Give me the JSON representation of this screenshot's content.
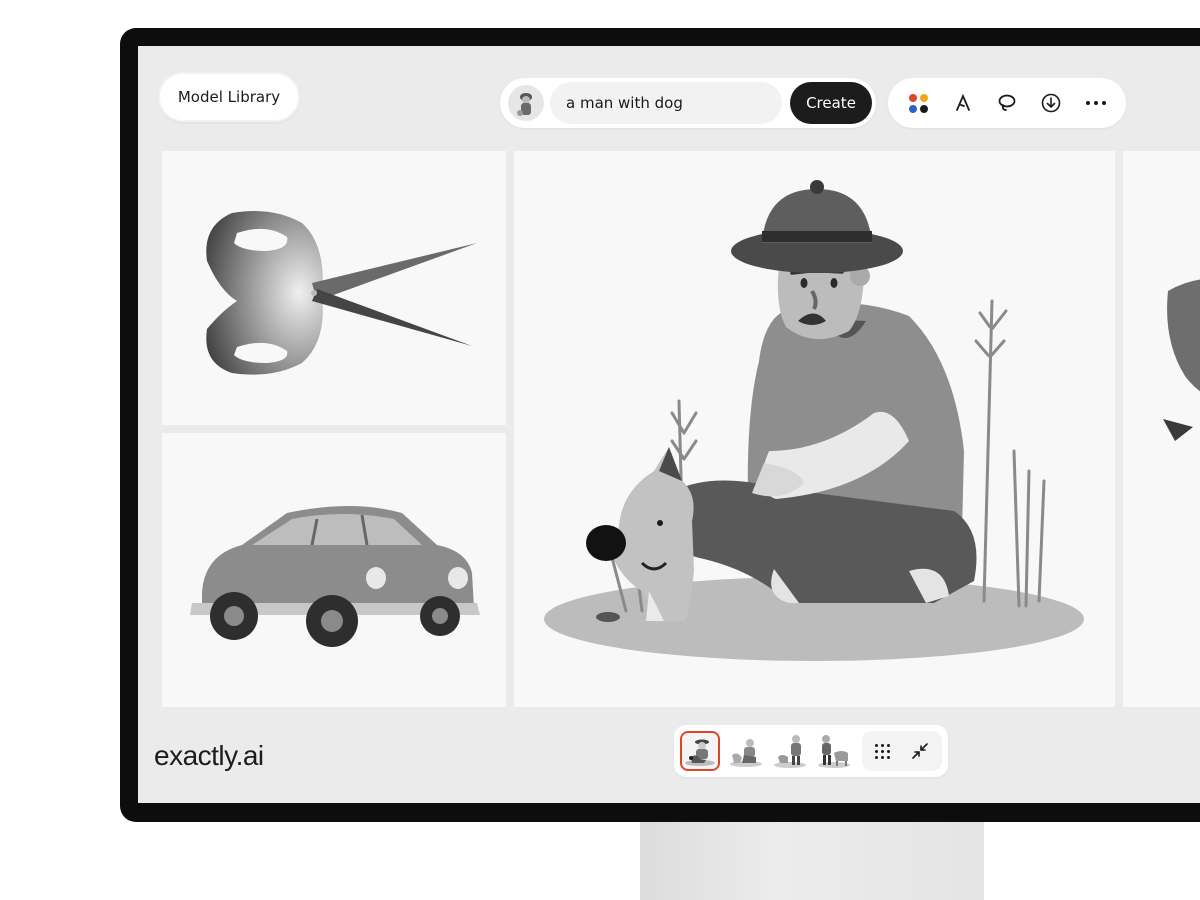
{
  "app": {
    "brand": "exactly.ai"
  },
  "header": {
    "model_library_label": "Model Library",
    "prompt": {
      "value": "a man with dog"
    },
    "create_label": "Create"
  },
  "toolbar": {
    "tools": [
      "palette-icon",
      "brush-icon",
      "lasso-icon",
      "download-icon",
      "more-icon"
    ],
    "palette_colors": [
      "#e0452b",
      "#f0a818",
      "#2a63c8",
      "#1a1a1a"
    ]
  },
  "gallery": {
    "items": [
      "scissors",
      "car",
      "man with dog",
      "bird"
    ],
    "selected": "man with dog"
  },
  "variations": {
    "count": 4,
    "selected_index": 0,
    "accent": "#e0452b",
    "tools": [
      "grid-icon",
      "collapse-icon"
    ]
  }
}
